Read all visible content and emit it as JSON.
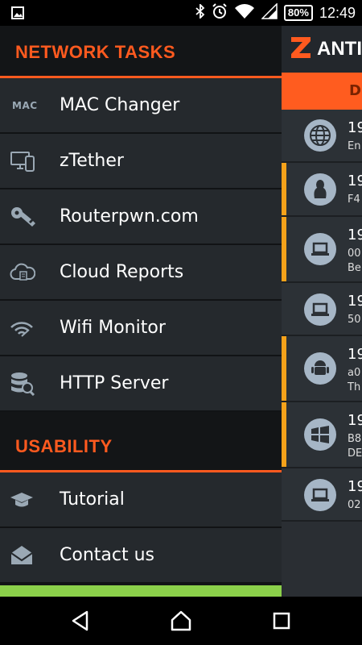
{
  "status_bar": {
    "battery": "80%",
    "time": "12:49",
    "icons": [
      "image-icon",
      "bluetooth-icon",
      "alarm-icon",
      "wifi-icon",
      "signal-icon",
      "battery-icon"
    ]
  },
  "background_app": {
    "title": "ANTI",
    "orange_bar_text": "D",
    "rows": [
      {
        "ip": "19",
        "sub1": "En",
        "sub2": "",
        "icon": "globe-icon",
        "flag": false
      },
      {
        "ip": "19",
        "sub1": "F4",
        "sub2": "",
        "icon": "linux-icon",
        "flag": true
      },
      {
        "ip": "19",
        "sub1": "00",
        "sub2": "Be",
        "icon": "laptop-icon",
        "flag": true
      },
      {
        "ip": "19",
        "sub1": "50",
        "sub2": "",
        "icon": "laptop-icon",
        "flag": false
      },
      {
        "ip": "19",
        "sub1": "a0",
        "sub2": "Th",
        "icon": "android-icon",
        "flag": true
      },
      {
        "ip": "19",
        "sub1": "B8",
        "sub2": "DE",
        "icon": "windows-icon",
        "flag": true
      },
      {
        "ip": "19",
        "sub1": "02",
        "sub2": "",
        "icon": "laptop-icon",
        "flag": false
      }
    ]
  },
  "drawer": {
    "network_tasks": {
      "title": "NETWORK TASKS",
      "items": [
        {
          "label": "MAC Changer",
          "icon": "mac-icon",
          "icon_text": "MAC"
        },
        {
          "label": "zTether",
          "icon": "devices-icon"
        },
        {
          "label": "Routerpwn.com",
          "icon": "key-icon"
        },
        {
          "label": "Cloud Reports",
          "icon": "cloud-icon"
        },
        {
          "label": "Wifi Monitor",
          "icon": "wifi-monitor-icon"
        },
        {
          "label": "HTTP Server",
          "icon": "server-icon"
        }
      ]
    },
    "usability": {
      "title": "USABILITY",
      "items": [
        {
          "label": "Tutorial",
          "icon": "graduation-cap-icon"
        },
        {
          "label": "Contact us",
          "icon": "envelope-icon"
        }
      ]
    }
  },
  "colors": {
    "accent": "#ff5a1f",
    "drawer_bg": "#131517",
    "item_bg": "#25292d",
    "icon_gray": "#9aa8b4",
    "green": "#8bd04a",
    "flag": "#f6a21a"
  },
  "nav_bar": {
    "buttons": [
      "back-icon",
      "home-icon",
      "recents-icon"
    ]
  }
}
